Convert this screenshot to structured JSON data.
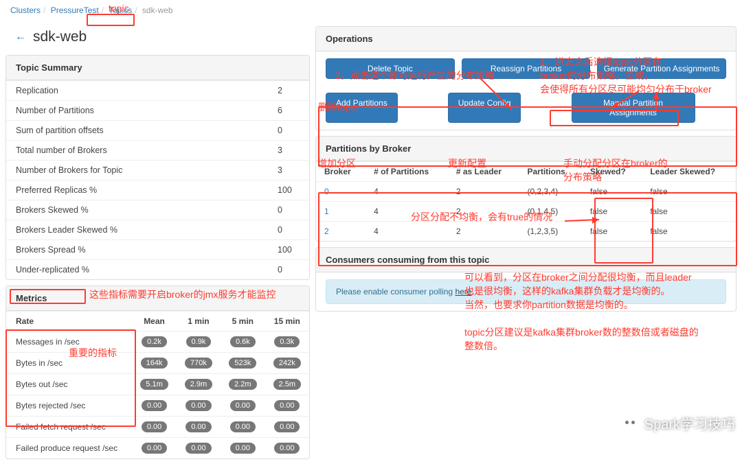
{
  "breadcrumb": {
    "items": [
      "Clusters",
      "PressureTest",
      "Topics"
    ],
    "current": "sdk-web"
  },
  "topicLabel": "sdk-web",
  "summary": {
    "heading": "Topic Summary",
    "rows": [
      {
        "k": "Replication",
        "v": "2"
      },
      {
        "k": "Number of Partitions",
        "v": "6"
      },
      {
        "k": "Sum of partition offsets",
        "v": "0"
      },
      {
        "k": "Total number of Brokers",
        "v": "3"
      },
      {
        "k": "Number of Brokers for Topic",
        "v": "3"
      },
      {
        "k": "Preferred Replicas %",
        "v": "100"
      },
      {
        "k": "Brokers Skewed %",
        "v": "0"
      },
      {
        "k": "Brokers Leader Skewed %",
        "v": "0"
      },
      {
        "k": "Brokers Spread %",
        "v": "100"
      },
      {
        "k": "Under-replicated %",
        "v": "0"
      }
    ]
  },
  "operations": {
    "heading": "Operations",
    "row1": [
      "Delete Topic",
      "Reassign Partitions",
      "Generate Partition Assignments"
    ],
    "row2": [
      "Add Partitions",
      "Update Config",
      "Manual Partition Assignments"
    ]
  },
  "partitions": {
    "heading": "Partitions by Broker",
    "cols": [
      "Broker",
      "# of Partitions",
      "# as Leader",
      "Partitions",
      "Skewed?",
      "Leader Skewed?"
    ],
    "rows": [
      {
        "broker": "0",
        "np": "4",
        "nl": "2",
        "parts": "(0,2,3,4)",
        "sk": "false",
        "lsk": "false"
      },
      {
        "broker": "1",
        "np": "4",
        "nl": "2",
        "parts": "(0,1,4,5)",
        "sk": "false",
        "lsk": "false"
      },
      {
        "broker": "2",
        "np": "4",
        "nl": "2",
        "parts": "(1,2,3,5)",
        "sk": "false",
        "lsk": "false"
      }
    ]
  },
  "consumers": {
    "heading": "Consumers consuming from this topic",
    "noticePrefix": "Please enable consumer polling ",
    "noticeLink": "here"
  },
  "metrics": {
    "heading": "Metrics",
    "cols": [
      "Rate",
      "Mean",
      "1 min",
      "5 min",
      "15 min"
    ],
    "rows": [
      {
        "n": "Messages in /sec",
        "v": [
          "0.2k",
          "0.9k",
          "0.6k",
          "0.3k"
        ]
      },
      {
        "n": "Bytes in /sec",
        "v": [
          "164k",
          "770k",
          "523k",
          "242k"
        ]
      },
      {
        "n": "Bytes out /sec",
        "v": [
          "5.1m",
          "2.9m",
          "2.2m",
          "2.5m"
        ]
      },
      {
        "n": "Bytes rejected /sec",
        "v": [
          "0.00",
          "0.00",
          "0.00",
          "0.00"
        ]
      },
      {
        "n": "Failed fetch request /sec",
        "v": [
          "0.00",
          "0.00",
          "0.00",
          "0.00"
        ]
      },
      {
        "n": "Failed produce request /sec",
        "v": [
          "0.00",
          "0.00",
          "0.00",
          "0.00"
        ]
      }
    ]
  },
  "ann": {
    "topic": "topic",
    "a1": "1，进去之后选择topic分区在\nbroker的分布策略，生成，\n会使得所有分区尽可能均匀分布于broker",
    "a2": "2，点击这个即可运行产生的分布策略",
    "del": "删除topic",
    "add": "增加分区",
    "upd": "更新配置",
    "man": "手动分配分区在broker的\n分布策略",
    "skew": "分区分配不均衡，会有true的情况",
    "ok": "可以看到，分区在broker之间分配很均衡，而且leader\n也是很均衡，这样的kafka集群负载才是均衡的。\n当然，也要求你partition数据是均衡的。",
    "tip": "topic分区建议是kafka集群broker数的整数倍或者磁盘的\n整数倍。",
    "jmx": "这些指标需要开启broker的jmx服务才能监控",
    "imp": "重要的指标"
  },
  "watermark": "Spark学习技巧"
}
